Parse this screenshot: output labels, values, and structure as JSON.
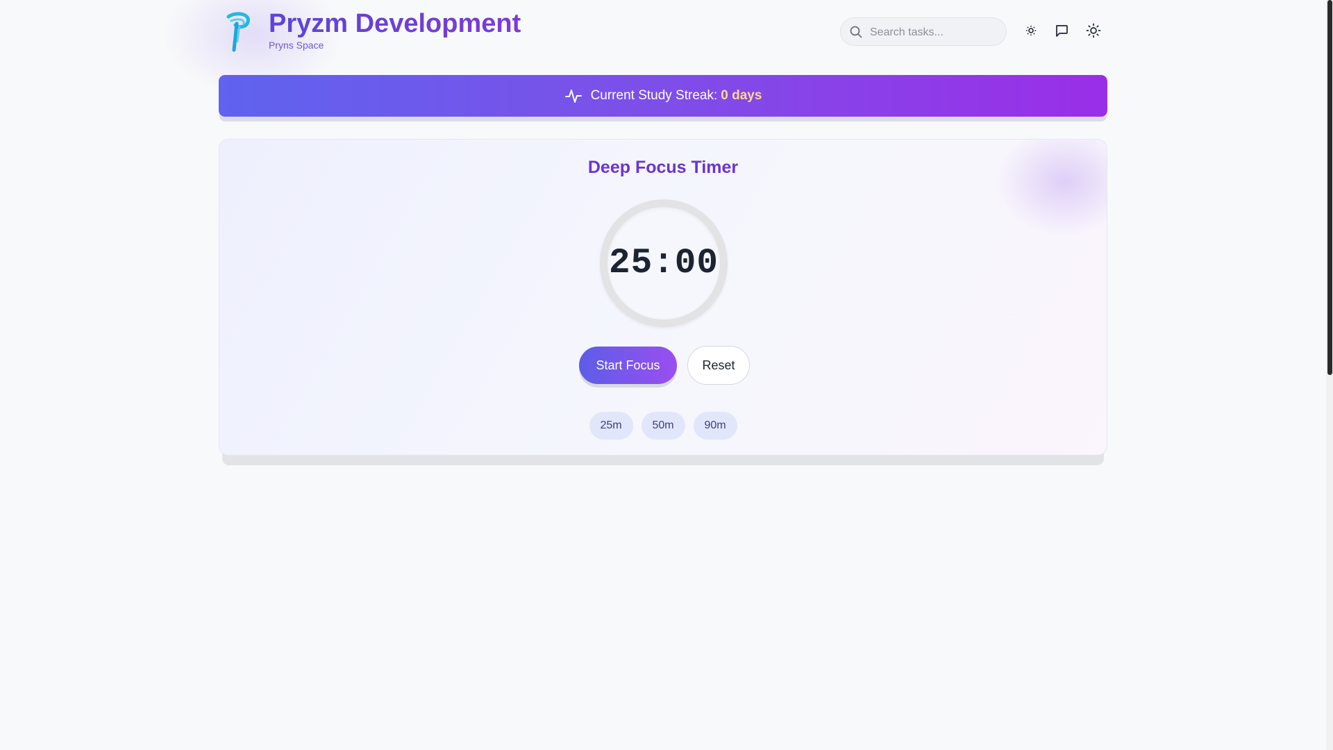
{
  "header": {
    "title": "Pryzm Development",
    "subtitle": "Pryns Space",
    "logo_icon": "pryzm-logo-icon",
    "search_placeholder": "Search tasks...",
    "icons": [
      "brightness-icon",
      "chat-icon",
      "sun-icon"
    ]
  },
  "streak": {
    "label": "Current Study Streak:",
    "value": "0 days",
    "icon": "activity-icon"
  },
  "timer": {
    "title": "Deep Focus Timer",
    "time": "25:00",
    "start_label": "Start Focus",
    "reset_label": "Reset",
    "presets": [
      "25m",
      "50m",
      "90m"
    ]
  },
  "colors": {
    "accent": "#6a35d0",
    "streak_value": "#ffd98a",
    "banner_start": "#5f63ef",
    "banner_end": "#9a2ee8",
    "logo": "#22b8e0"
  }
}
